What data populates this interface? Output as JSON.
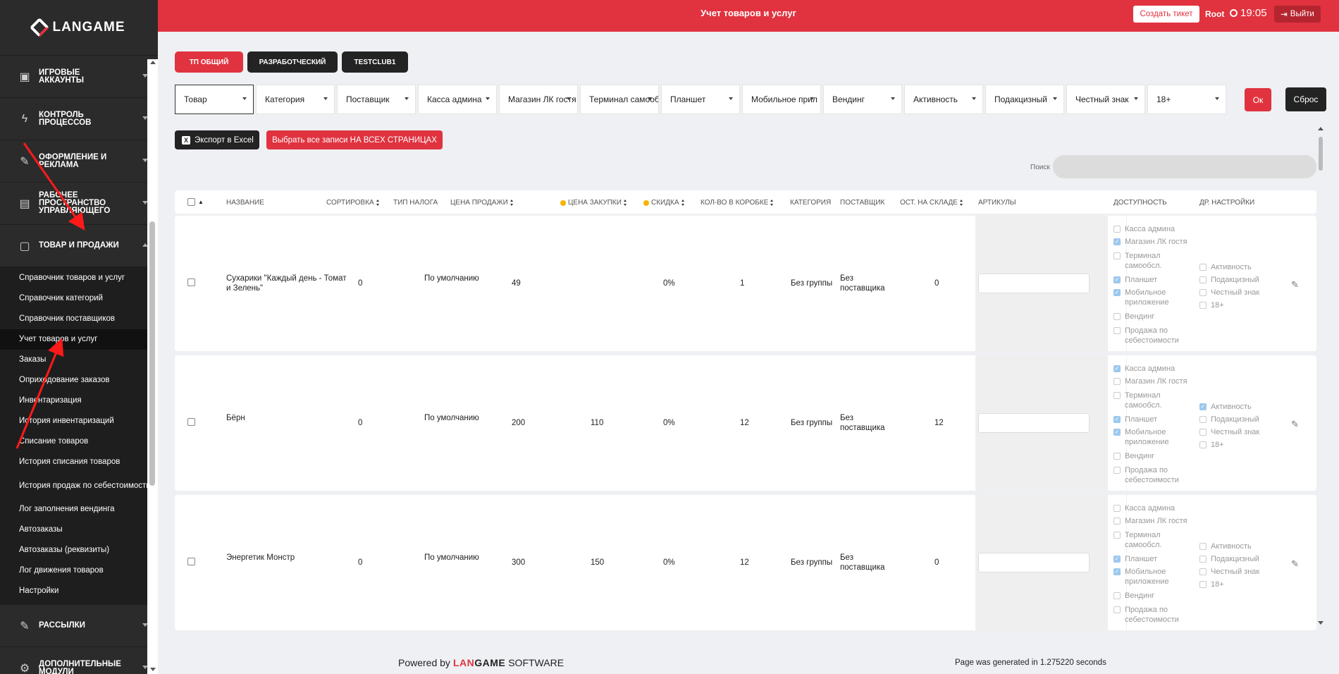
{
  "app": {
    "brand": "LANGAME"
  },
  "sidebar": {
    "sections": [
      {
        "label": "Игровые аккаунты",
        "icon": "id-card-icon"
      },
      {
        "label": "Контроль процессов",
        "icon": "bolt-icon"
      },
      {
        "label": "Оформление и реклама",
        "icon": "edit-icon"
      },
      {
        "label": "Рабочее пространство управляющего",
        "icon": "briefcase-icon"
      },
      {
        "label": "Товар и продажи",
        "icon": "note-icon"
      }
    ],
    "sub_items": [
      "Справочник товаров и услуг",
      "Справочник категорий",
      "Справочник поставщиков",
      "Учет товаров и услуг",
      "Заказы",
      "Оприходование заказов",
      "Инвентаризация",
      "История инвентаризаций",
      "Списание товаров",
      "История списания товаров",
      "История продаж по себестоимости",
      "Лог заполнения вендинга",
      "Автозаказы",
      "Автозаказы (реквизиты)",
      "Лог движения товаров",
      "Настройки"
    ],
    "bottom_sections": [
      {
        "label": "Рассылки",
        "icon": "edit-icon"
      },
      {
        "label": "Дополнительные модули",
        "icon": "gear-icon"
      }
    ]
  },
  "topbar": {
    "title": "Учет товаров и услуг",
    "ticket_label": "Создать тикет",
    "user": "Root",
    "time": "19:05",
    "logout_label": "Выйти"
  },
  "tabs": [
    "ТП ОБЩИЙ",
    "РАЗРАБОТЧЕСКИЙ",
    "TESTCLUB1"
  ],
  "filters": [
    "Товар",
    "Категория",
    "Поставщик",
    "Касса админа",
    "Магазин ЛК гостя",
    "Терминал самооб",
    "Планшет",
    "Мобильное прил",
    "Вендинг",
    "Активность",
    "Подакцизный",
    "Честный знак",
    "18+"
  ],
  "actions": {
    "ok": "Ок",
    "reset": "Сброс",
    "export": "Экспорт в Excel",
    "select_all": "Выбрать все записи НА ВСЕХ СТРАНИЦАХ",
    "search_label": "Поиск"
  },
  "table": {
    "headers": [
      "Название",
      "Сортировка",
      "Тип налога",
      "Цена продажи",
      "Цена закупки",
      "Скидка",
      "Кол-во в коробке",
      "Категория",
      "Поставщик",
      "Ост. на складе",
      "Артикулы",
      "Доступность",
      "Др. настройки"
    ],
    "availability_labels": [
      "Касса админа",
      "Магазин ЛК гостя",
      "Терминал самообсл.",
      "Планшет",
      "Мобильное приложение",
      "Вендинг",
      "Продажа по себестоимости"
    ],
    "other_labels": [
      "Активность",
      "Подакцизный",
      "Честный знак",
      "18+"
    ],
    "rows": [
      {
        "name": "Сухарики \"Каждый день - Томат и Зелень\"",
        "sort": "0",
        "tax": "По умолчанию",
        "price": "49",
        "cost": "",
        "discount": "0%",
        "box": "1",
        "category": "Без группы",
        "supplier": "Без поставщика",
        "stock": "0",
        "avail": [
          false,
          true,
          false,
          true,
          true,
          false,
          false
        ],
        "other": [
          false,
          false,
          false,
          false
        ]
      },
      {
        "name": "Бёрн",
        "sort": "0",
        "tax": "По умолчанию",
        "price": "200",
        "cost": "110",
        "discount": "0%",
        "box": "12",
        "category": "Без группы",
        "supplier": "Без поставщика",
        "stock": "12",
        "avail": [
          true,
          false,
          false,
          true,
          true,
          false,
          false
        ],
        "other": [
          true,
          false,
          false,
          false
        ]
      },
      {
        "name": "Энергетик Монстр",
        "sort": "0",
        "tax": "По умолчанию",
        "price": "300",
        "cost": "150",
        "discount": "0%",
        "box": "12",
        "category": "Без группы",
        "supplier": "Без поставщика",
        "stock": "0",
        "avail": [
          false,
          false,
          false,
          true,
          true,
          false,
          false
        ],
        "other": [
          false,
          false,
          false,
          false
        ]
      }
    ]
  },
  "footer": {
    "powered_prefix": "Powered by",
    "powered_brand_a": "LAN",
    "powered_brand_b": "GAME",
    "powered_suffix": "SOFTWARE",
    "generated": "Page was generated in 1.275220 seconds"
  },
  "colors": {
    "accent": "#e0333f",
    "sidebar": "#2b2b2b",
    "dark_button": "#232323"
  }
}
